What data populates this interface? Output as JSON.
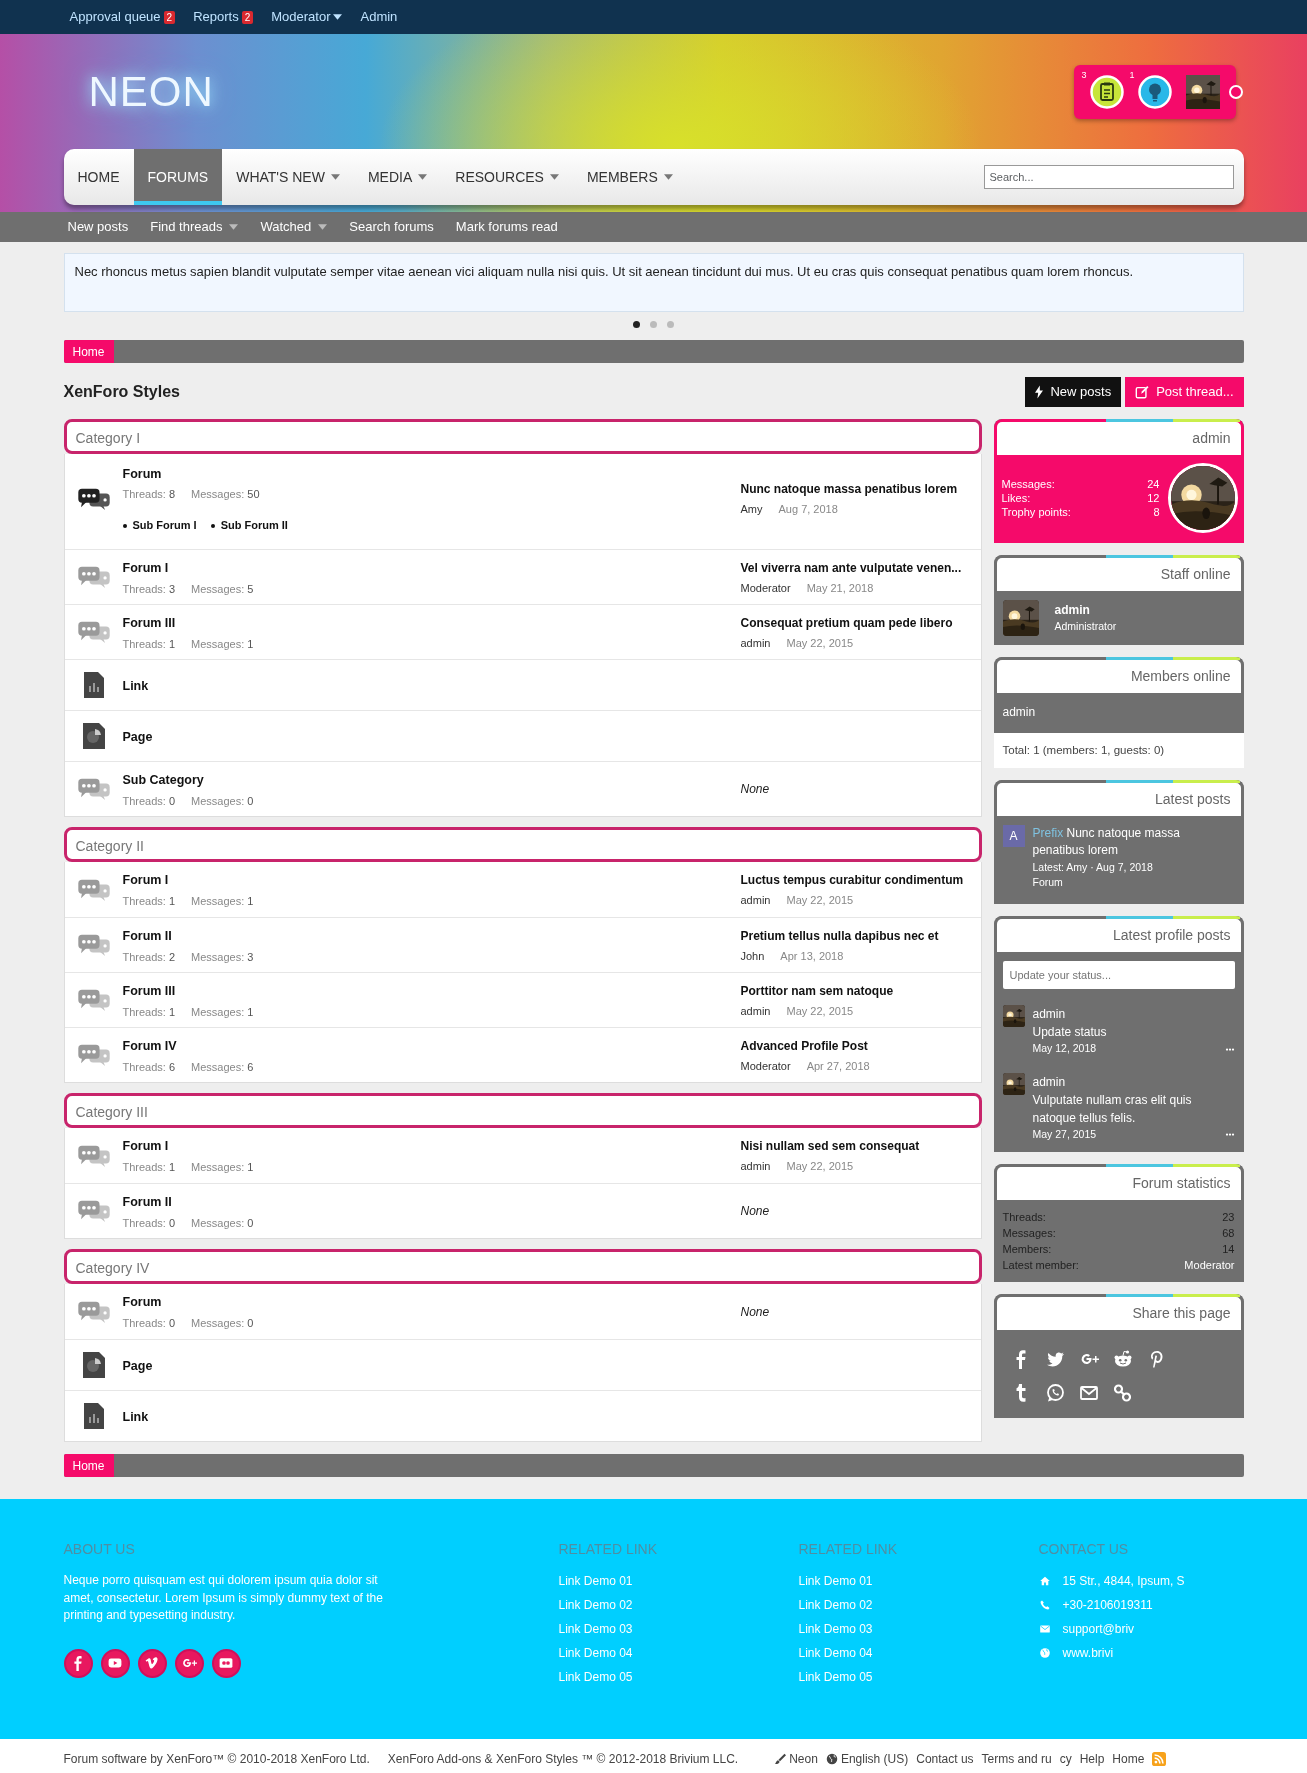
{
  "top_bar": [
    {
      "label": "Approval queue",
      "badge": "2",
      "has_menu": false
    },
    {
      "label": "Reports",
      "badge": "2",
      "has_menu": false
    },
    {
      "label": "Moderator",
      "has_menu": true
    },
    {
      "label": "Admin",
      "has_menu": false
    }
  ],
  "logo": "NEON",
  "user_box": {
    "alerts": [
      {
        "kind": "clipboard",
        "count": "3"
      },
      {
        "kind": "bulb",
        "count": "1"
      }
    ]
  },
  "nav": {
    "tabs": [
      {
        "label": "HOME",
        "selected": false,
        "has_menu": false
      },
      {
        "label": "FORUMS",
        "selected": true,
        "has_menu": false
      },
      {
        "label": "WHAT'S NEW",
        "selected": false,
        "has_menu": true
      },
      {
        "label": "MEDIA",
        "selected": false,
        "has_menu": true
      },
      {
        "label": "RESOURCES",
        "selected": false,
        "has_menu": true
      },
      {
        "label": "MEMBERS",
        "selected": false,
        "has_menu": true
      }
    ],
    "search": {
      "placeholder": "Search..."
    }
  },
  "sub_nav": [
    {
      "label": "New posts",
      "has_menu": false
    },
    {
      "label": "Find threads",
      "has_menu": true
    },
    {
      "label": "Watched",
      "has_menu": true
    },
    {
      "label": "Search forums",
      "has_menu": false
    },
    {
      "label": "Mark forums read",
      "has_menu": false
    }
  ],
  "notice": {
    "text": "Nec rhoncus metus sapien blandit vulputate semper vitae aenean vici aliquam nulla nisi quis. Ut sit aenean tincidunt dui mus. Ut eu cras quis consequat penatibus quam lorem rhoncus.",
    "slides": [
      {
        "selected": true
      },
      {
        "selected": false
      },
      {
        "selected": false
      }
    ]
  },
  "breadcrumb_top": [
    "Home"
  ],
  "page_title": "XenForo Styles",
  "buttons": [
    {
      "kind": "new_posts",
      "label": "New posts"
    },
    {
      "kind": "post_thread",
      "label": "Post thread..."
    }
  ],
  "categories": [
    {
      "title": "Category I",
      "nodes": [
        {
          "kind": "forum",
          "title": "Forum",
          "unread": true,
          "stats": [
            {
              "label": "Threads:",
              "value": "8"
            },
            {
              "label": "Messages:",
              "value": "50"
            }
          ],
          "sub_forums": [
            "Sub Forum I",
            "Sub Forum II"
          ],
          "last_post": {
            "title": "Nunc natoque massa penatibus lorem",
            "user": "Amy",
            "date": "Aug 7, 2018"
          }
        },
        {
          "kind": "forum",
          "title": "Forum I",
          "unread": false,
          "stats": [
            {
              "label": "Threads:",
              "value": "3"
            },
            {
              "label": "Messages:",
              "value": "5"
            }
          ],
          "last_post": {
            "title": "Vel viverra nam ante vulputate venen...",
            "user": "Moderator",
            "date": "May 21, 2018"
          }
        },
        {
          "kind": "forum",
          "title": "Forum III",
          "unread": false,
          "stats": [
            {
              "label": "Threads:",
              "value": "1"
            },
            {
              "label": "Messages:",
              "value": "1"
            }
          ],
          "last_post": {
            "title": "Consequat pretium quam pede libero",
            "user": "admin",
            "date": "May 22, 2015"
          }
        },
        {
          "kind": "link",
          "title": "Link"
        },
        {
          "kind": "page",
          "title": "Page"
        },
        {
          "kind": "forum",
          "title": "Sub Category",
          "unread": false,
          "stats": [
            {
              "label": "Threads:",
              "value": "0"
            },
            {
              "label": "Messages:",
              "value": "0"
            }
          ],
          "no_post": "None"
        }
      ]
    },
    {
      "title": "Category II",
      "nodes": [
        {
          "kind": "forum",
          "title": "Forum I",
          "unread": false,
          "stats": [
            {
              "label": "Threads:",
              "value": "1"
            },
            {
              "label": "Messages:",
              "value": "1"
            }
          ],
          "last_post": {
            "title": "Luctus tempus curabitur condimentum",
            "user": "admin",
            "date": "May 22, 2015"
          }
        },
        {
          "kind": "forum",
          "title": "Forum II",
          "unread": false,
          "stats": [
            {
              "label": "Threads:",
              "value": "2"
            },
            {
              "label": "Messages:",
              "value": "3"
            }
          ],
          "last_post": {
            "title": "Pretium tellus nulla dapibus nec et",
            "user": "John",
            "date": "Apr 13, 2018"
          }
        },
        {
          "kind": "forum",
          "title": "Forum III",
          "unread": false,
          "stats": [
            {
              "label": "Threads:",
              "value": "1"
            },
            {
              "label": "Messages:",
              "value": "1"
            }
          ],
          "last_post": {
            "title": "Porttitor nam sem natoque",
            "user": "admin",
            "date": "May 22, 2015"
          }
        },
        {
          "kind": "forum",
          "title": "Forum IV",
          "unread": false,
          "stats": [
            {
              "label": "Threads:",
              "value": "6"
            },
            {
              "label": "Messages:",
              "value": "6"
            }
          ],
          "last_post": {
            "title": "Advanced Profile Post",
            "user": "Moderator",
            "date": "Apr 27, 2018"
          }
        }
      ]
    },
    {
      "title": "Category III",
      "nodes": [
        {
          "kind": "forum",
          "title": "Forum I",
          "unread": false,
          "stats": [
            {
              "label": "Threads:",
              "value": "1"
            },
            {
              "label": "Messages:",
              "value": "1"
            }
          ],
          "last_post": {
            "title": "Nisi nullam sed sem consequat",
            "user": "admin",
            "date": "May 22, 2015"
          }
        },
        {
          "kind": "forum",
          "title": "Forum II",
          "unread": false,
          "stats": [
            {
              "label": "Threads:",
              "value": "0"
            },
            {
              "label": "Messages:",
              "value": "0"
            }
          ],
          "no_post": "None"
        }
      ]
    },
    {
      "title": "Category IV",
      "nodes": [
        {
          "kind": "forum",
          "title": "Forum",
          "unread": false,
          "stats": [
            {
              "label": "Threads:",
              "value": "0"
            },
            {
              "label": "Messages:",
              "value": "0"
            }
          ],
          "no_post": "None"
        },
        {
          "kind": "page",
          "title": "Page"
        },
        {
          "kind": "link",
          "title": "Link"
        }
      ]
    }
  ],
  "breadcrumb_bottom": [
    "Home"
  ],
  "sidebar": [
    {
      "kind": "user",
      "title": "admin",
      "stats": [
        {
          "label": "Messages:",
          "value": "24"
        },
        {
          "label": "Likes:",
          "value": "12"
        },
        {
          "label": "Trophy points:",
          "value": "8"
        }
      ]
    },
    {
      "kind": "staff",
      "title": "Staff online",
      "members": [
        {
          "name": "admin",
          "role": "Administrator"
        }
      ]
    },
    {
      "kind": "members",
      "title": "Members online",
      "names": [
        "admin"
      ],
      "total": "Total: 1 (members: 1, guests: 0)"
    },
    {
      "kind": "posts",
      "title": "Latest posts",
      "posts": [
        {
          "letter": "A",
          "prefix": "Prefix",
          "title": "Nunc natoque massa penatibus lorem",
          "latest": "Latest: Amy · Aug 7, 2018",
          "forum": "Forum"
        }
      ]
    },
    {
      "kind": "profile_posts",
      "title": "Latest profile posts",
      "placeholder": "Update your status...",
      "posts": [
        {
          "user": "admin",
          "text": "Update status",
          "date": "May 12, 2018"
        },
        {
          "user": "admin",
          "text": "Vulputate nullam cras elit quis natoque tellus felis.",
          "date": "May 27, 2015"
        }
      ]
    },
    {
      "kind": "stats",
      "title": "Forum statistics",
      "rows": [
        {
          "label": "Threads:",
          "value": "23",
          "link": false
        },
        {
          "label": "Messages:",
          "value": "68",
          "link": false
        },
        {
          "label": "Members:",
          "value": "14",
          "link": false
        },
        {
          "label": "Latest member:",
          "value": "Moderator",
          "link": true
        }
      ]
    },
    {
      "kind": "share",
      "title": "Share this page"
    }
  ],
  "footer": {
    "about": {
      "title": "ABOUT US",
      "text": "Neque porro quisquam est qui dolorem ipsum quia dolor sit amet, consectetur. Lorem Ipsum is simply dummy text of the printing and typesetting industry."
    },
    "link_columns": [
      {
        "title": "RELATED LINK",
        "links": [
          "Link Demo 01",
          "Link Demo 02",
          "Link Demo 03",
          "Link Demo 04",
          "Link Demo 05"
        ]
      },
      {
        "title": "RELATED LINK",
        "links": [
          "Link Demo 01",
          "Link Demo 02",
          "Link Demo 03",
          "Link Demo 04",
          "Link Demo 05"
        ]
      }
    ],
    "contact": {
      "title": "CONTACT US",
      "items": [
        {
          "kind": "home",
          "text": "15 Str., 4844, Ipsum, S"
        },
        {
          "kind": "phone",
          "text": "+30-2106019311"
        },
        {
          "kind": "mail",
          "text": "support@briv"
        },
        {
          "kind": "globe",
          "text": "www.brivi"
        }
      ]
    }
  },
  "bottom_bar": {
    "left": [
      "Forum software by XenForo™ © 2010-2018 XenForo Ltd.",
      "XenForo Add-ons & XenForo Styles ™ © 2012-2018 Brivium LLC."
    ],
    "right": [
      {
        "kind": "brush",
        "label": "Neon"
      },
      {
        "kind": "globe",
        "label": "English (US)"
      },
      {
        "kind": "text",
        "label": "Contact us"
      },
      {
        "kind": "text",
        "label": "Terms and ru"
      },
      {
        "kind": "text",
        "label": "cy"
      },
      {
        "kind": "text",
        "label": "Help"
      },
      {
        "kind": "text",
        "label": "Home"
      },
      {
        "kind": "rss"
      }
    ]
  }
}
